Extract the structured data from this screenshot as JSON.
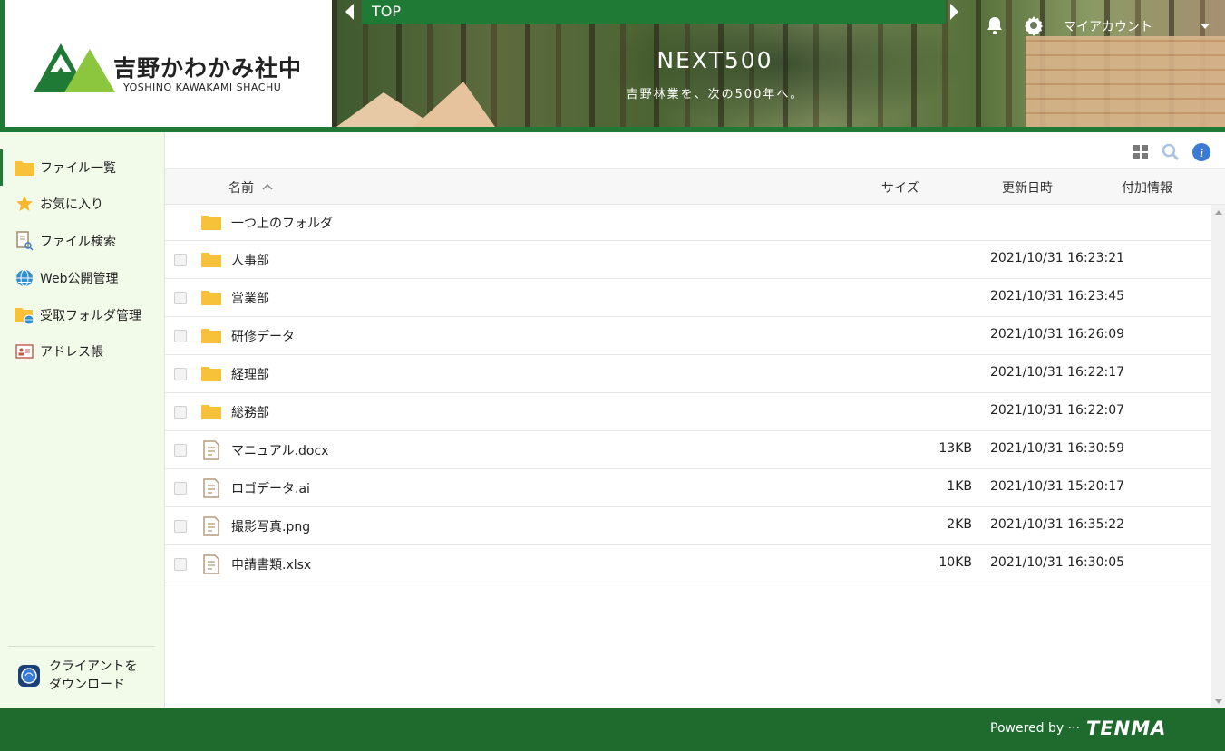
{
  "header": {
    "logo_jp": "吉野かわかみ社中",
    "logo_en": "YOSHINO KAWAKAMI SHACHU",
    "top_label": "TOP",
    "banner_title": "NEXT500",
    "banner_subtitle": "吉野林業を、次の500年へ。",
    "account_label": "マイアカウント"
  },
  "sidebar": {
    "items": [
      {
        "label": "ファイル一覧",
        "icon": "folder-icon"
      },
      {
        "label": "お気に入り",
        "icon": "star-icon"
      },
      {
        "label": "ファイル検索",
        "icon": "file-search-icon"
      },
      {
        "label": "Web公開管理",
        "icon": "globe-icon"
      },
      {
        "label": "受取フォルダ管理",
        "icon": "folder-globe-icon"
      },
      {
        "label": "アドレス帳",
        "icon": "address-card-icon"
      }
    ],
    "download_line1": "クライアントを",
    "download_line2": "ダウンロード"
  },
  "list": {
    "columns": {
      "name": "名前",
      "size": "サイズ",
      "modified": "更新日時",
      "info": "付加情報"
    },
    "parent_folder": "一つ上のフォルダ",
    "rows": [
      {
        "type": "folder",
        "name": "人事部",
        "size": "",
        "date": "2021/10/31 16:23:21"
      },
      {
        "type": "folder",
        "name": "営業部",
        "size": "",
        "date": "2021/10/31 16:23:45"
      },
      {
        "type": "folder",
        "name": "研修データ",
        "size": "",
        "date": "2021/10/31 16:26:09"
      },
      {
        "type": "folder",
        "name": "経理部",
        "size": "",
        "date": "2021/10/31 16:22:17"
      },
      {
        "type": "folder",
        "name": "総務部",
        "size": "",
        "date": "2021/10/31 16:22:07"
      },
      {
        "type": "file",
        "name": "マニュアル.docx",
        "size": "13KB",
        "date": "2021/10/31 16:30:59"
      },
      {
        "type": "file",
        "name": "ロゴデータ.ai",
        "size": "1KB",
        "date": "2021/10/31 15:20:17"
      },
      {
        "type": "file",
        "name": "撮影写真.png",
        "size": "2KB",
        "date": "2021/10/31 16:35:22"
      },
      {
        "type": "file",
        "name": "申請書類.xlsx",
        "size": "10KB",
        "date": "2021/10/31 16:30:05"
      }
    ]
  },
  "footer": {
    "powered": "Powered by ···",
    "brand": "TENMA"
  },
  "colors": {
    "brand_green": "#1f7a35",
    "folder_yellow": "#f7c23a",
    "info_blue": "#3a7bd5"
  }
}
